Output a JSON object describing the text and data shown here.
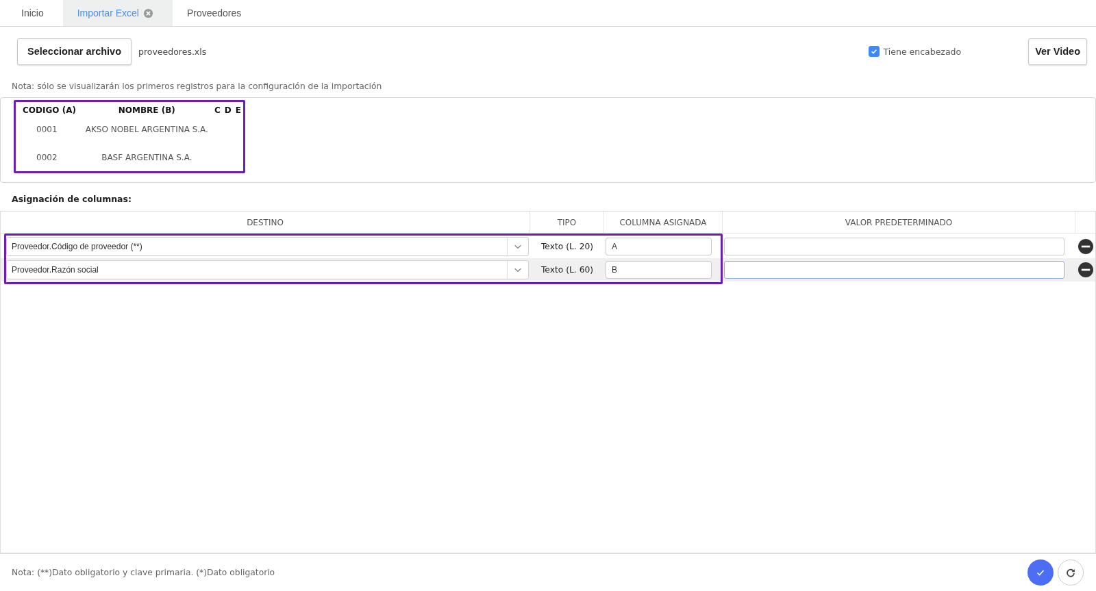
{
  "tabs": [
    {
      "label": "Inicio",
      "selected": false,
      "closable": false
    },
    {
      "label": "Importar Excel",
      "selected": true,
      "closable": true
    },
    {
      "label": "Proveedores",
      "selected": false,
      "closable": false
    }
  ],
  "toolbar": {
    "select_button": "Seleccionar archivo",
    "file_name": "proveedores.xls",
    "has_header": {
      "label": "Tiene encabezado",
      "checked": true
    },
    "video_button": "Ver Video"
  },
  "preview_note": "Nota: sólo se visualizarán los primeros registros para la configuración de la importación",
  "preview": {
    "columns": [
      "CODIGO (A)",
      "NOMBRE (B)",
      "C",
      "D",
      "E"
    ],
    "rows": [
      [
        "0001",
        "AKSO NOBEL ARGENTINA S.A."
      ],
      [
        "0002",
        "BASF ARGENTINA S.A."
      ]
    ]
  },
  "mapping": {
    "title": "Asignación de columnas:",
    "columns": [
      "DESTINO",
      "TIPO",
      "COLUMNA ASIGNADA",
      "VALOR PREDETERMINADO"
    ],
    "rows": [
      {
        "destino": "Proveedor.Código de proveedor (**)",
        "tipo": "Texto (L. 20)",
        "columna": "A",
        "selected": false
      },
      {
        "destino": "Proveedor.Razón social",
        "tipo": "Texto (L. 60)",
        "columna": "B",
        "selected": true
      }
    ]
  },
  "footer_note": "Nota: (**)Dato obligatorio y clave primaria. (*)Dato obligatorio"
}
